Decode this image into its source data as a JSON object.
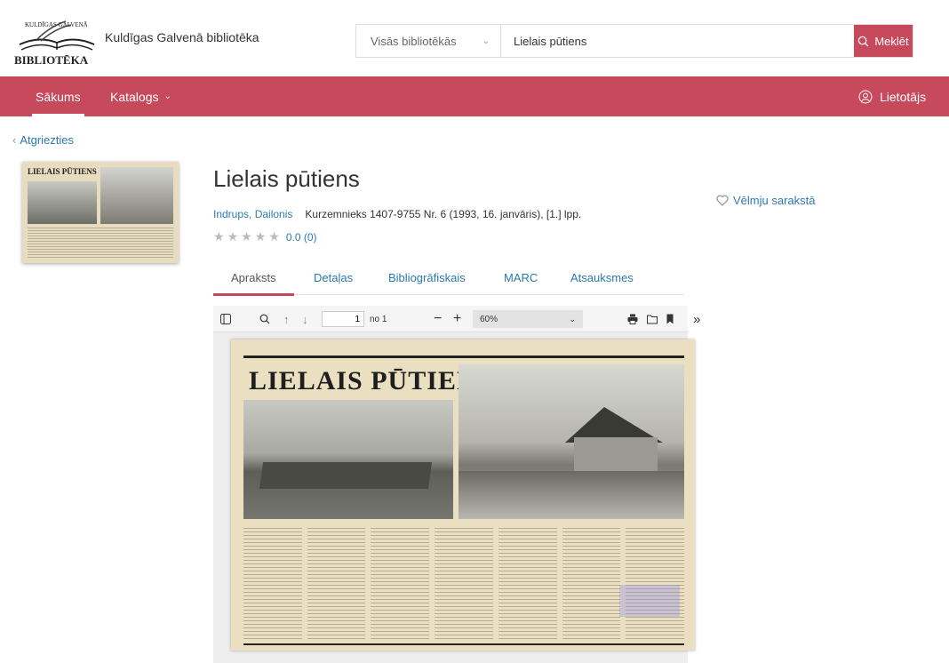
{
  "header": {
    "logo_top": "KULDĪGAS GALVENĀ",
    "logo_bottom": "BIBLIOTĒKA",
    "library_name": "Kuldīgas Galvenā bibliotēka",
    "search_scope": "Visās bibliotēkās",
    "search_query": "Lielais pūtiens",
    "search_button": "Meklēt"
  },
  "nav": {
    "home": "Sākums",
    "catalog": "Katalogs",
    "user": "Lietotājs"
  },
  "back_link": "Atgriezties",
  "record": {
    "thumb_headline": "LIELAIS PŪTIENS",
    "title": "Lielais pūtiens",
    "author": "Indrups, Dailonis",
    "source": "Kurzemnieks 1407-9755 Nr. 6 (1993, 16. janvāris), [1.] lpp.",
    "rating_score": "0.0 (0)",
    "rating_stars": 0,
    "wishlist": "Vēlmju sarakstā"
  },
  "tabs": [
    {
      "label": "Apraksts"
    },
    {
      "label": "Detaļas"
    },
    {
      "label": "Bibliogrāfiskais"
    },
    {
      "label": "MARC"
    },
    {
      "label": "Atsauksmes"
    }
  ],
  "viewer": {
    "page_number": "1",
    "page_total": "no 1",
    "zoom": "60%"
  },
  "document": {
    "headline": "LIELAIS PŪTIENS"
  },
  "colors": {
    "accent": "#c7495c",
    "link": "#2a7ab0"
  }
}
